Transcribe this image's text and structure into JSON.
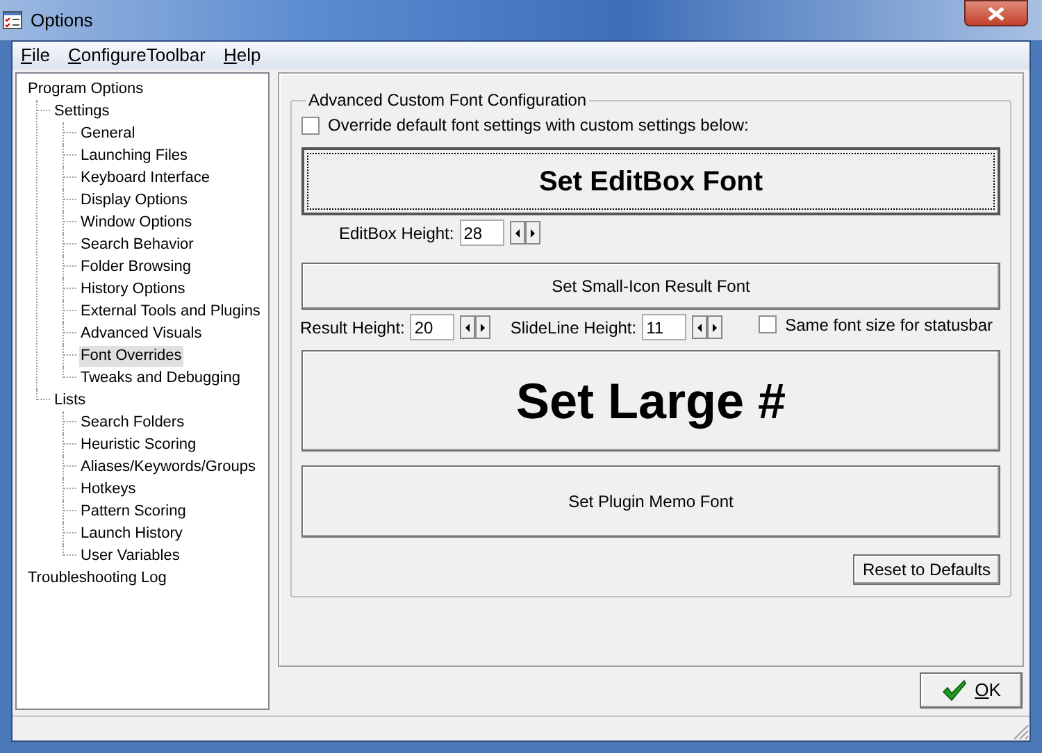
{
  "window": {
    "title": "Options"
  },
  "menu": [
    {
      "label": "File"
    },
    {
      "label": "ConfigureToolbar"
    },
    {
      "label": "Help"
    }
  ],
  "tree": [
    {
      "label": "Program Options",
      "selected": false,
      "children": [
        {
          "label": "Settings",
          "selected": false,
          "children": [
            {
              "label": "General",
              "selected": false
            },
            {
              "label": "Launching Files",
              "selected": false
            },
            {
              "label": "Keyboard Interface",
              "selected": false
            },
            {
              "label": "Display Options",
              "selected": false
            },
            {
              "label": "Window Options",
              "selected": false
            },
            {
              "label": "Search Behavior",
              "selected": false
            },
            {
              "label": "Folder Browsing",
              "selected": false
            },
            {
              "label": "History Options",
              "selected": false
            },
            {
              "label": "External Tools and Plugins",
              "selected": false
            },
            {
              "label": "Advanced Visuals",
              "selected": false
            },
            {
              "label": "Font Overrides",
              "selected": true
            },
            {
              "label": "Tweaks and Debugging",
              "selected": false
            }
          ]
        },
        {
          "label": "Lists",
          "selected": false,
          "children": [
            {
              "label": "Search Folders",
              "selected": false
            },
            {
              "label": "Heuristic Scoring",
              "selected": false
            },
            {
              "label": "Aliases/Keywords/Groups",
              "selected": false
            },
            {
              "label": "Hotkeys",
              "selected": false
            },
            {
              "label": "Pattern Scoring",
              "selected": false
            },
            {
              "label": "Launch History",
              "selected": false
            },
            {
              "label": "User Variables",
              "selected": false
            }
          ]
        }
      ]
    },
    {
      "label": "Troubleshooting Log",
      "selected": false
    }
  ],
  "group": {
    "title": "Advanced Custom Font Configuration",
    "override": {
      "label": "Override default font settings with custom settings below:",
      "checked": false
    },
    "editbox_font_button": "Set EditBox Font",
    "editbox_height": {
      "label": "EditBox Height:",
      "value": "28"
    },
    "small_icon_button": "Set Small-Icon Result Font",
    "result_height": {
      "label": "Result Height:",
      "value": "20"
    },
    "slideline_height": {
      "label": "SlideLine Height:",
      "value": "11"
    },
    "statusbar_same": {
      "label": "Same font size for statusbar",
      "checked": false
    },
    "large_button": "Set Large #",
    "memo_button": "Set Plugin Memo Font",
    "reset_button": "Reset to Defaults"
  },
  "ok_button": "OK"
}
